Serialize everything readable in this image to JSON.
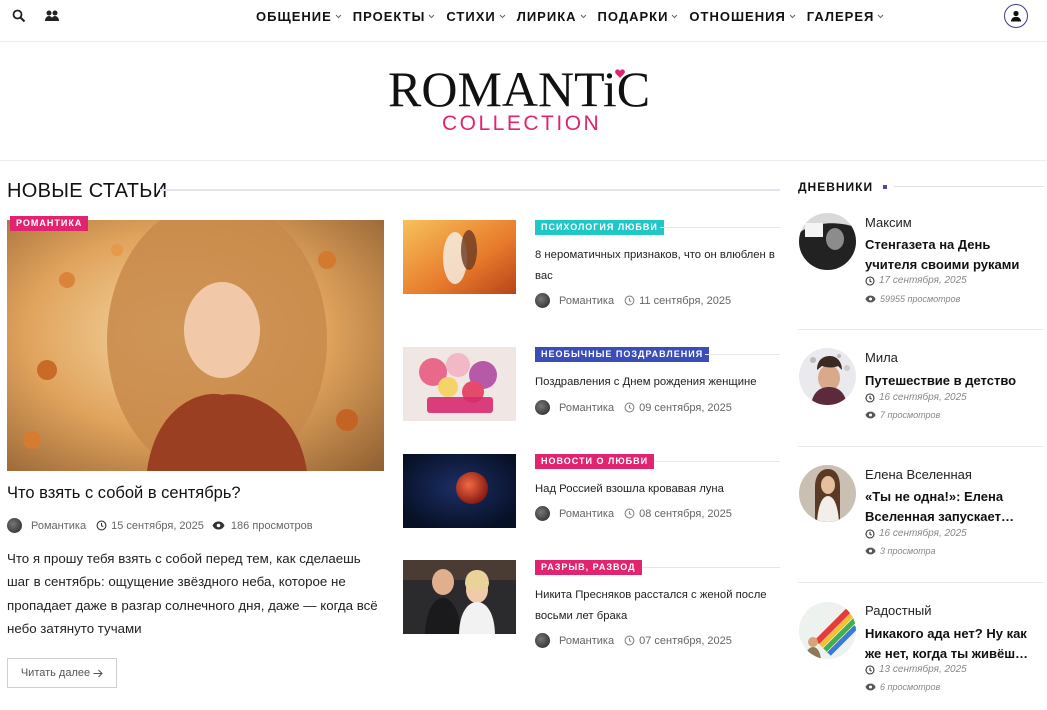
{
  "topbar": {
    "search_icon": "search-icon",
    "community_icon": "users-icon",
    "user_icon": "user-icon"
  },
  "nav": {
    "items": [
      {
        "label": "ОБЩЕНИЕ"
      },
      {
        "label": "ПРОЕКТЫ"
      },
      {
        "label": "СТИХИ"
      },
      {
        "label": "ЛИРИКА"
      },
      {
        "label": "ПОДАРКИ"
      },
      {
        "label": "ОТНОШЕНИЯ"
      },
      {
        "label": "ГАЛЕРЕЯ"
      }
    ]
  },
  "logo": {
    "main": "ROMANTiC",
    "sub": "COLLECTION",
    "accent_color": "#e0246f"
  },
  "section": {
    "title": "НОВЫЕ СТАТЬИ"
  },
  "featured": {
    "badge": "РОМАНТИКА",
    "badge_color": "#e0246f",
    "title": "Что взять с собой в сентябрь?",
    "author": "Романтика",
    "date": "15 сентября, 2025",
    "views": "186 просмотров",
    "excerpt": "Что я прошу тебя взять с собой перед тем, как сделаешь шаг в сентябрь: ощущение звёздного неба, которое не пропадает даже в разгар солнечного дня, даже — когда всё небо затянуто тучами",
    "read_more": "Читать далее"
  },
  "articles": [
    {
      "badge": "ПСИХОЛОГИЯ ЛЮБВИ",
      "badge_color": "#1fc7c7",
      "title": "8 нероматичных признаков, что он влюблен в вас",
      "author": "Романтика",
      "date": "11 сентября, 2025"
    },
    {
      "badge": "НЕОБЫЧНЫЕ ПОЗДРАВЛЕНИЯ",
      "badge_color": "#3d4db7",
      "title": "Поздравления с Днем рождения женщине",
      "author": "Романтика",
      "date": "09 сентября, 2025"
    },
    {
      "badge": "НОВОСТИ О ЛЮБВИ",
      "badge_color": "#e0246f",
      "title": "Над Россией взошла кровавая луна",
      "author": "Романтика",
      "date": "08 сентября, 2025"
    },
    {
      "badge": "РАЗРЫВ, РАЗВОД",
      "badge_color": "#e0246f",
      "title": "Никита Пресняков расстался с женой после восьми лет брака",
      "author": "Романтика",
      "date": "07 сентября, 2025"
    }
  ],
  "sidebar": {
    "title": "ДНЕВНИКИ",
    "items": [
      {
        "author": "Максим",
        "title": "Стенгазета на День учителя своими руками",
        "date": "17 сентября, 2025",
        "views": "59955 просмотров"
      },
      {
        "author": "Мила",
        "title": "Путешествие в детство",
        "date": "16 сентября, 2025",
        "views": "7 просмотров"
      },
      {
        "author": "Елена Вселенная",
        "title": "«Ты не одна!»: Елена Вселенная запускает…",
        "date": "16 сентября, 2025",
        "views": "3 просмотра"
      },
      {
        "author": "Радостный",
        "title": "Никакого ада нет? Ну как же нет, когда ты живёш…",
        "date": "13 сентября, 2025",
        "views": "6 просмотров"
      }
    ]
  }
}
